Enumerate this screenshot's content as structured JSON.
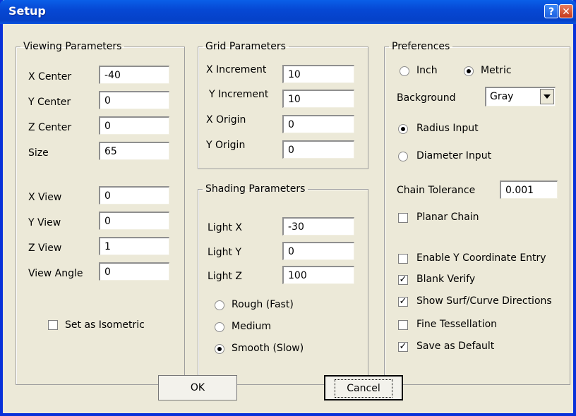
{
  "window": {
    "title": "Setup",
    "help_label": "?",
    "close_label": "✕"
  },
  "viewing": {
    "legend": "Viewing Parameters",
    "x_center_label": "X Center",
    "x_center": "-40",
    "y_center_label": "Y Center",
    "y_center": "0",
    "z_center_label": "Z Center",
    "z_center": "0",
    "size_label": "Size",
    "size": "65",
    "x_view_label": "X View",
    "x_view": "0",
    "y_view_label": "Y View",
    "y_view": "0",
    "z_view_label": "Z View",
    "z_view": "1",
    "view_angle_label": "View Angle",
    "view_angle": "0",
    "isometric_label": "Set as Isometric",
    "isometric_checked": false
  },
  "grid": {
    "legend": "Grid Parameters",
    "x_increment_label": "X Increment",
    "x_increment": "10",
    "y_increment_label": "Y Increment",
    "y_increment": "10",
    "x_origin_label": "X Origin",
    "x_origin": "0",
    "y_origin_label": "Y Origin",
    "y_origin": "0"
  },
  "shading": {
    "legend": "Shading Parameters",
    "light_x_label": "Light X",
    "light_x": "-30",
    "light_y_label": "Light Y",
    "light_y": "0",
    "light_z_label": "Light Z",
    "light_z": "100",
    "rough_label": "Rough (Fast)",
    "medium_label": "Medium",
    "smooth_label": "Smooth (Slow)",
    "selected": "smooth"
  },
  "preferences": {
    "legend": "Preferences",
    "inch_label": "Inch",
    "metric_label": "Metric",
    "units_selected": "metric",
    "background_label": "Background",
    "background_value": "Gray",
    "radius_label": "Radius Input",
    "diameter_label": "Diameter Input",
    "input_selected": "radius",
    "chain_tolerance_label": "Chain Tolerance",
    "chain_tolerance": "0.001",
    "planar_chain_label": "Planar Chain",
    "planar_chain": false,
    "enable_y_label": "Enable Y Coordinate Entry",
    "enable_y": false,
    "blank_verify_label": "Blank Verify",
    "blank_verify": true,
    "show_dirs_label": "Show Surf/Curve Directions",
    "show_dirs": true,
    "fine_tess_label": "Fine Tessellation",
    "fine_tess": false,
    "save_default_label": "Save as Default",
    "save_default": true
  },
  "buttons": {
    "ok": "OK",
    "cancel": "Cancel"
  },
  "colors": {
    "titlebar": "#0648d4",
    "face": "#ece9d8"
  }
}
